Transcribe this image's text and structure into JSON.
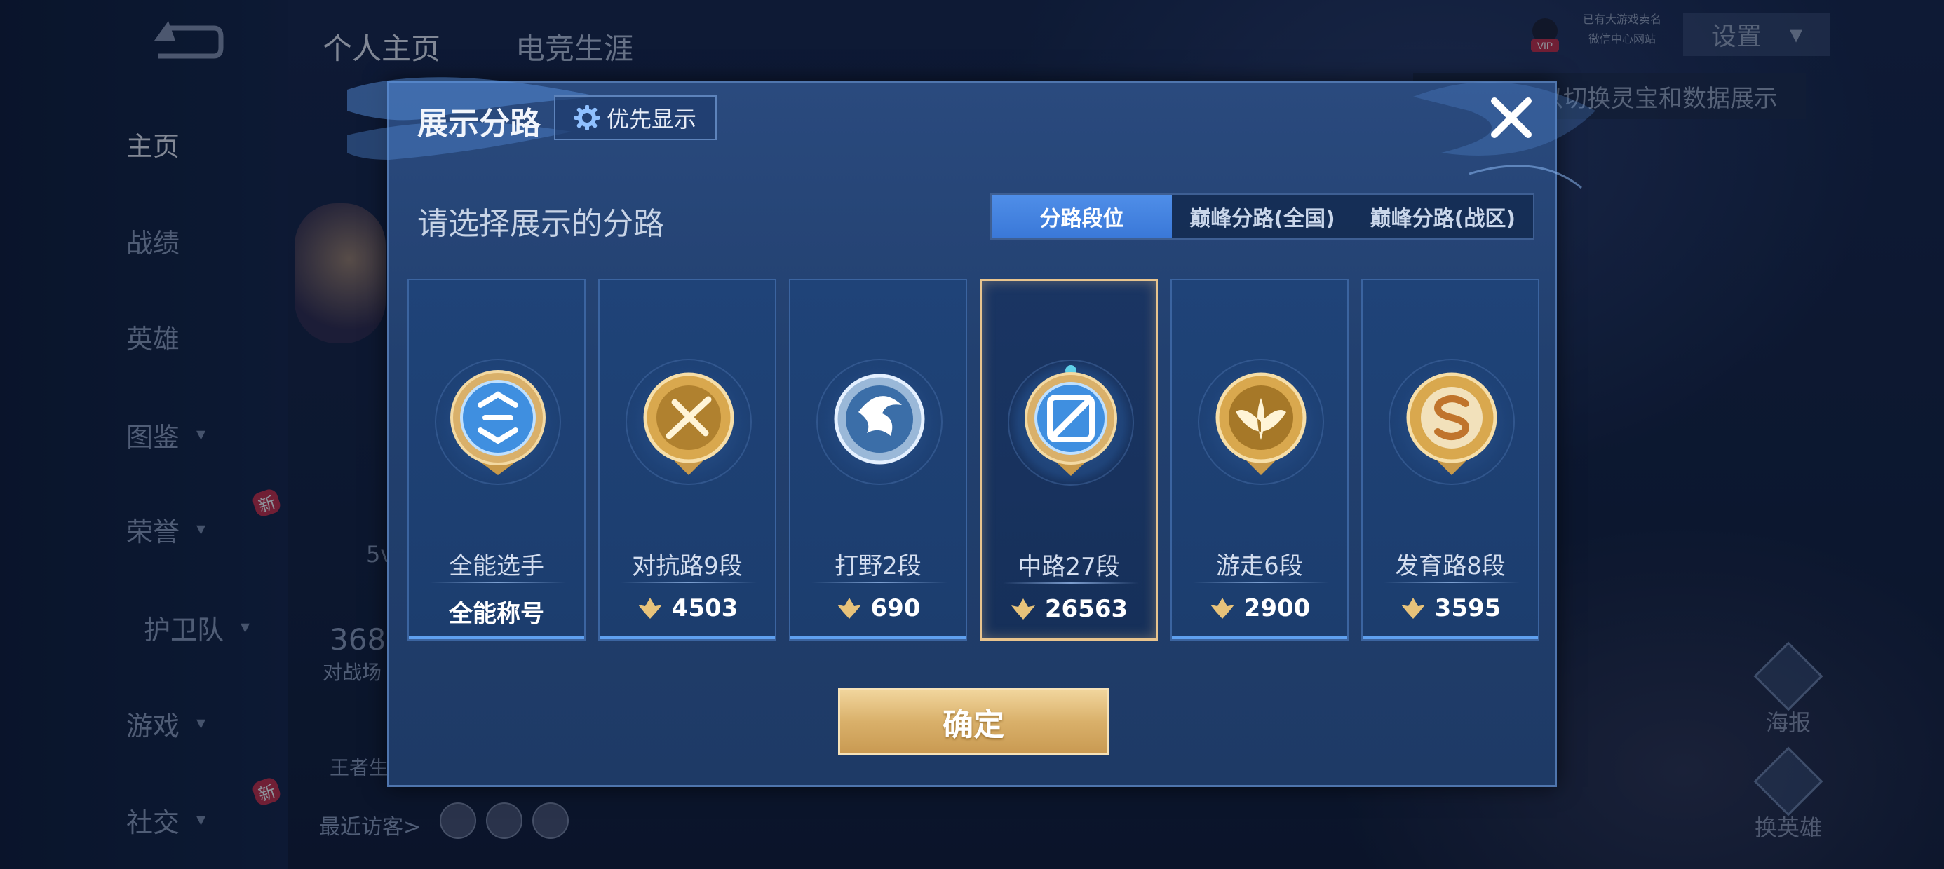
{
  "background": {
    "top_tabs": [
      "个人主页",
      "电竞生涯"
    ],
    "nav": [
      {
        "label": "主页",
        "active": true,
        "caret": false,
        "new": false
      },
      {
        "label": "战绩",
        "active": false,
        "caret": false,
        "new": false
      },
      {
        "label": "英雄",
        "active": false,
        "caret": false,
        "new": false
      },
      {
        "label": "图鉴",
        "active": false,
        "caret": true,
        "new": false
      },
      {
        "label": "荣誉",
        "active": false,
        "caret": true,
        "new": true
      },
      {
        "label": "护卫队",
        "active": false,
        "caret": true,
        "new": false
      },
      {
        "label": "游戏",
        "active": false,
        "caret": true,
        "new": false
      },
      {
        "label": "社交",
        "active": false,
        "caret": true,
        "new": true
      }
    ],
    "new_badge": "新",
    "side_texts": [
      "5v",
      "368",
      "对战场",
      "王者生",
      "最近访客>"
    ],
    "vip_label": "VIP",
    "vip_line1": "已有大游戏卖名",
    "vip_line2": "微信中心网站",
    "settings_label": "设置",
    "tooltip_text": "以切换灵宝和数据展示",
    "right_buttons": [
      "海报",
      "换英雄"
    ]
  },
  "modal": {
    "title": "展示分路",
    "priority_button": "优先显示",
    "subtitle": "请选择展示的分路",
    "tabs": [
      {
        "label": "分路段位",
        "active": true
      },
      {
        "label": "巅峰分路(全国)",
        "active": false
      },
      {
        "label": "巅峰分路(战区)",
        "active": false
      }
    ],
    "cards": [
      {
        "name": "全能选手",
        "value": "全能称号",
        "show_points_icon": false,
        "selected": false,
        "badge": "all-round-badge-icon",
        "badge_color": "#3f8fe0"
      },
      {
        "name": "对抗路9段",
        "value": "4503",
        "show_points_icon": true,
        "selected": false,
        "badge": "clash-lane-badge-icon",
        "badge_color": "#d9a84e"
      },
      {
        "name": "打野2段",
        "value": "690",
        "show_points_icon": true,
        "selected": false,
        "badge": "jungle-badge-icon",
        "badge_color": "#9ab8d8"
      },
      {
        "name": "中路27段",
        "value": "26563",
        "show_points_icon": true,
        "selected": true,
        "badge": "mid-lane-badge-icon",
        "badge_color": "#3f8fe0"
      },
      {
        "name": "游走6段",
        "value": "2900",
        "show_points_icon": true,
        "selected": false,
        "badge": "roam-badge-icon",
        "badge_color": "#d9a84e"
      },
      {
        "name": "发育路8段",
        "value": "3595",
        "show_points_icon": true,
        "selected": false,
        "badge": "farm-lane-badge-icon",
        "badge_color": "#d9a84e"
      }
    ],
    "confirm_button": "确定",
    "colors": {
      "accent_tab": "#3a78d8",
      "selected_border": "#e8c48e",
      "confirm_gold": "#d9b06a"
    }
  }
}
